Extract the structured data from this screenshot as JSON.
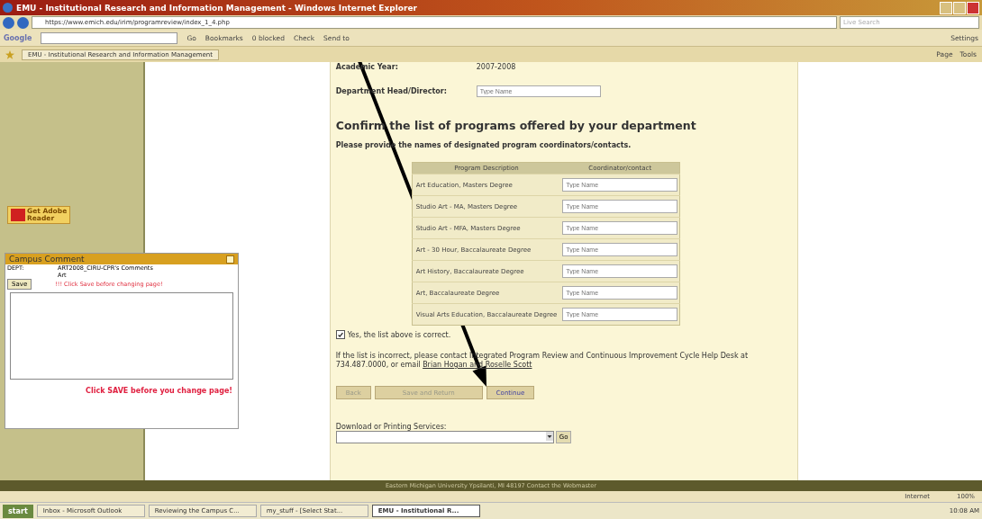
{
  "window": {
    "title": "EMU - Institutional Research and Information Management - Windows Internet Explorer"
  },
  "address_bar": {
    "url": "https://www.emich.edu/irim/programreview/index_1_4.php",
    "search_placeholder": "Live Search"
  },
  "google_toolbar": {
    "label": "Google",
    "items": [
      "Go",
      "Bookmarks",
      "0 blocked",
      "Check",
      "Send to"
    ],
    "settings": "Settings"
  },
  "tab": {
    "label": "EMU - Institutional Research and Information Management"
  },
  "command_bar": [
    "Page",
    "Tools"
  ],
  "form": {
    "year_label": "Academic Year:",
    "year": "2007-2008",
    "head_label": "Department Head/Director:",
    "head_placeholder": "Type Name",
    "heading": "Confirm the list of programs offered by your department",
    "subheading": "Please provide the names of designated program coordinators/contacts.",
    "columns": [
      "Program Description",
      "Coordinator/contact"
    ],
    "programs": [
      {
        "name": "Art Education, Masters Degree",
        "placeholder": "Type Name"
      },
      {
        "name": "Studio Art - MA, Masters Degree",
        "placeholder": "Type Name"
      },
      {
        "name": "Studio Art - MFA, Masters Degree",
        "placeholder": "Type Name"
      },
      {
        "name": "Art - 30 Hour, Baccalaureate Degree",
        "placeholder": "Type Name"
      },
      {
        "name": "Art History, Baccalaureate Degree",
        "placeholder": "Type Name"
      },
      {
        "name": "Art, Baccalaureate Degree",
        "placeholder": "Type Name"
      },
      {
        "name": "Visual Arts Education, Baccalaureate Degree",
        "placeholder": "Type Name"
      }
    ],
    "confirm": {
      "label": "Yes, the list above is correct.",
      "checked": true
    },
    "note": "If the list is incorrect, please contact Integrated Program Review and Continuous Improvement Cycle Help Desk at 734.487.0000, or email ",
    "note_link": "Brian Hogan and Roselle Scott",
    "buttons": [
      "Back",
      "Save and Return",
      "Continue"
    ],
    "download_label": "Download or Printing Services:",
    "go": "Go"
  },
  "footer": "Eastern Michigan University Ypsilanti, MI 48197 Contact the Webmaster",
  "sidebar": {
    "adobe": [
      "Get Adobe",
      "Reader"
    ]
  },
  "comment_panel": {
    "title": "Campus Comment",
    "subject": "ART2008_CIRU-CPR's Comments",
    "dept_label": "DEPT:",
    "dept": "Art",
    "save": "Save",
    "hint": "!!! Click Save before changing page!",
    "warning": "Click SAVE before you change page!"
  },
  "status_bar": {
    "zone": "Internet",
    "zoom": "100%"
  },
  "taskbar": {
    "start": "start",
    "items": [
      {
        "label": "Inbox - Microsoft Outlook",
        "selected": false
      },
      {
        "label": "Reviewing the Campus C...",
        "selected": false
      },
      {
        "label": "my_stuff - [Select Stat...",
        "selected": false
      },
      {
        "label": "EMU - Institutional R...",
        "selected": true
      }
    ],
    "clock": "10:08 AM"
  }
}
